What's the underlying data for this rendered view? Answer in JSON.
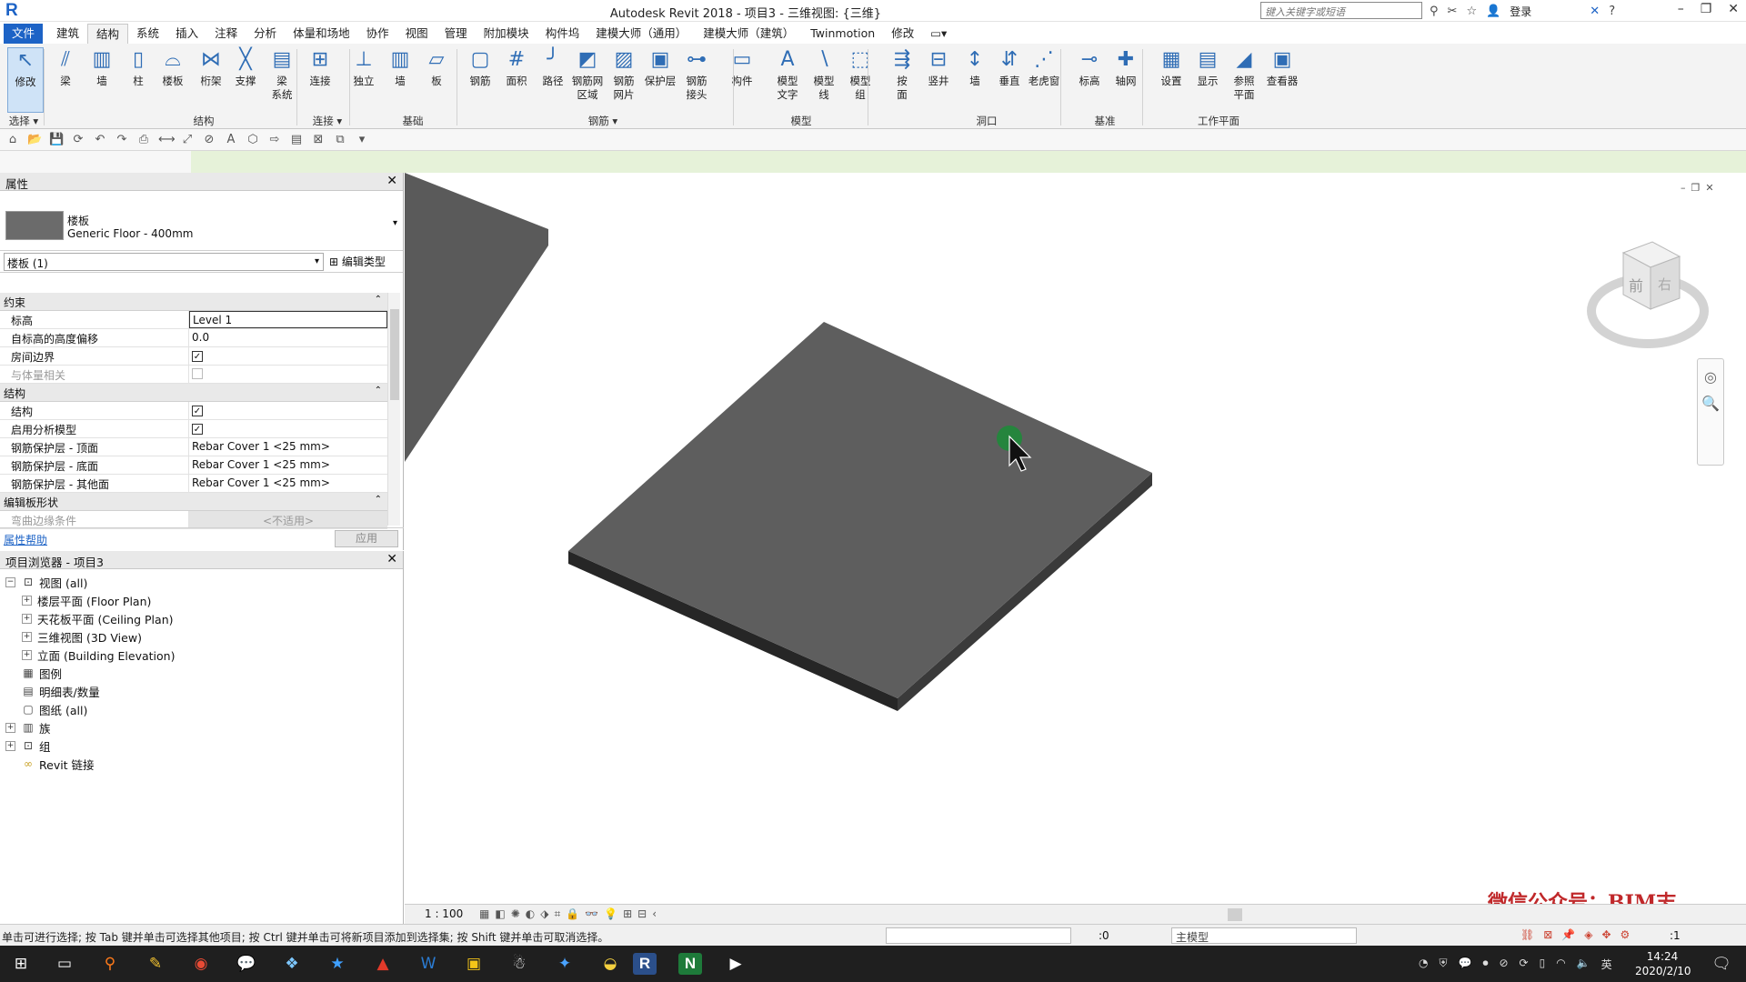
{
  "window": {
    "logo": "R",
    "title": "Autodesk Revit 2018 -    项目3 - 三维视图: {三维}",
    "search_placeholder": "键入关键字或短语",
    "login": "登录"
  },
  "ribbon_tabs": [
    "文件",
    "建筑",
    "结构",
    "系统",
    "插入",
    "注释",
    "分析",
    "体量和场地",
    "协作",
    "视图",
    "管理",
    "附加模块",
    "构件坞",
    "建模大师（通用）",
    "建模大师（建筑）",
    "Twinmotion",
    "修改"
  ],
  "ribbon": {
    "buttons": [
      "修改",
      "梁",
      "墙",
      "柱",
      "楼板",
      "桁架",
      "支撑",
      "梁\n系统",
      "连接",
      "独立",
      "墙",
      "板",
      "钢筋",
      "面积",
      "路径",
      "钢筋网\n区域",
      "钢筋\n网片",
      "保护层",
      "钢筋\n接头",
      "构件",
      "模型\n文字",
      "模型\n线",
      "模型\n组",
      "按\n面",
      "竖井",
      "墙",
      "垂直",
      "老虎窗",
      "标高",
      "轴网",
      "设置",
      "显示",
      "参照\n平面",
      "查看器"
    ],
    "groups": [
      "选择 ▾",
      "结构",
      "连接 ▾",
      "基础",
      "钢筋 ▾",
      "模型",
      "洞口",
      "基准",
      "工作平面"
    ]
  },
  "properties": {
    "title": "属性",
    "type_family": "楼板",
    "type_name": "Generic Floor - 400mm",
    "instance": "楼板 (1)",
    "edit_type": "编辑类型",
    "categories": [
      {
        "name": "约束",
        "rows": [
          {
            "label": "标高",
            "value": "Level 1",
            "kind": "text"
          },
          {
            "label": "自标高的高度偏移",
            "value": "0.0",
            "kind": "text"
          },
          {
            "label": "房间边界",
            "value": "✓",
            "kind": "check"
          },
          {
            "label": "与体量相关",
            "value": "",
            "kind": "check-off"
          }
        ]
      },
      {
        "name": "结构",
        "rows": [
          {
            "label": "结构",
            "value": "✓",
            "kind": "check"
          },
          {
            "label": "启用分析模型",
            "value": "✓",
            "kind": "check"
          },
          {
            "label": "钢筋保护层 - 顶面",
            "value": "Rebar Cover 1 <25 mm>",
            "kind": "text"
          },
          {
            "label": "钢筋保护层 - 底面",
            "value": "Rebar Cover 1 <25 mm>",
            "kind": "text"
          },
          {
            "label": "钢筋保护层 - 其他面",
            "value": "Rebar Cover 1 <25 mm>",
            "kind": "text"
          }
        ]
      },
      {
        "name": "编辑板形状",
        "rows": [
          {
            "label": "弯曲边缘条件",
            "value": "<不适用>",
            "kind": "na"
          }
        ]
      }
    ],
    "help": "属性帮助",
    "apply": "应用"
  },
  "browser": {
    "title": "项目浏览器 - 项目3",
    "nodes": [
      {
        "label": "视图 (all)",
        "level": 0,
        "exp": "−"
      },
      {
        "label": "楼层平面 (Floor Plan)",
        "level": 1,
        "exp": "+"
      },
      {
        "label": "天花板平面 (Ceiling Plan)",
        "level": 1,
        "exp": "+"
      },
      {
        "label": "三维视图 (3D View)",
        "level": 1,
        "exp": "+"
      },
      {
        "label": "立面 (Building Elevation)",
        "level": 1,
        "exp": "+"
      },
      {
        "label": "图例",
        "level": 0,
        "exp": ""
      },
      {
        "label": "明细表/数量",
        "level": 0,
        "exp": ""
      },
      {
        "label": "图纸 (all)",
        "level": 0,
        "exp": ""
      },
      {
        "label": "族",
        "level": 0,
        "exp": "+"
      },
      {
        "label": "组",
        "level": 0,
        "exp": "+"
      },
      {
        "label": "Revit 链接",
        "level": 0,
        "exp": ""
      }
    ]
  },
  "viewcube": {
    "face": "前",
    "side": "右"
  },
  "viewbar": {
    "scale": "1 : 100"
  },
  "watermark": "微信公众号：BIM志",
  "status": {
    "hint": "单击可进行选择; 按 Tab 键并单击可选择其他项目; 按 Ctrl 键并单击可将新项目添加到选择集; 按 Shift 键并单击可取消选择。",
    "wp_count": ":0",
    "active_model": "主模型",
    "filter_count": ":1"
  },
  "taskbar": {
    "time": "14:24",
    "date": "2020/2/10",
    "lang": "英"
  },
  "colors": {
    "accent": "#1d63c6",
    "floor_top": "#5e5e5e",
    "floor_edge": "#262626",
    "options_bar": "#e6f2d9",
    "watermark": "#c0282a"
  }
}
